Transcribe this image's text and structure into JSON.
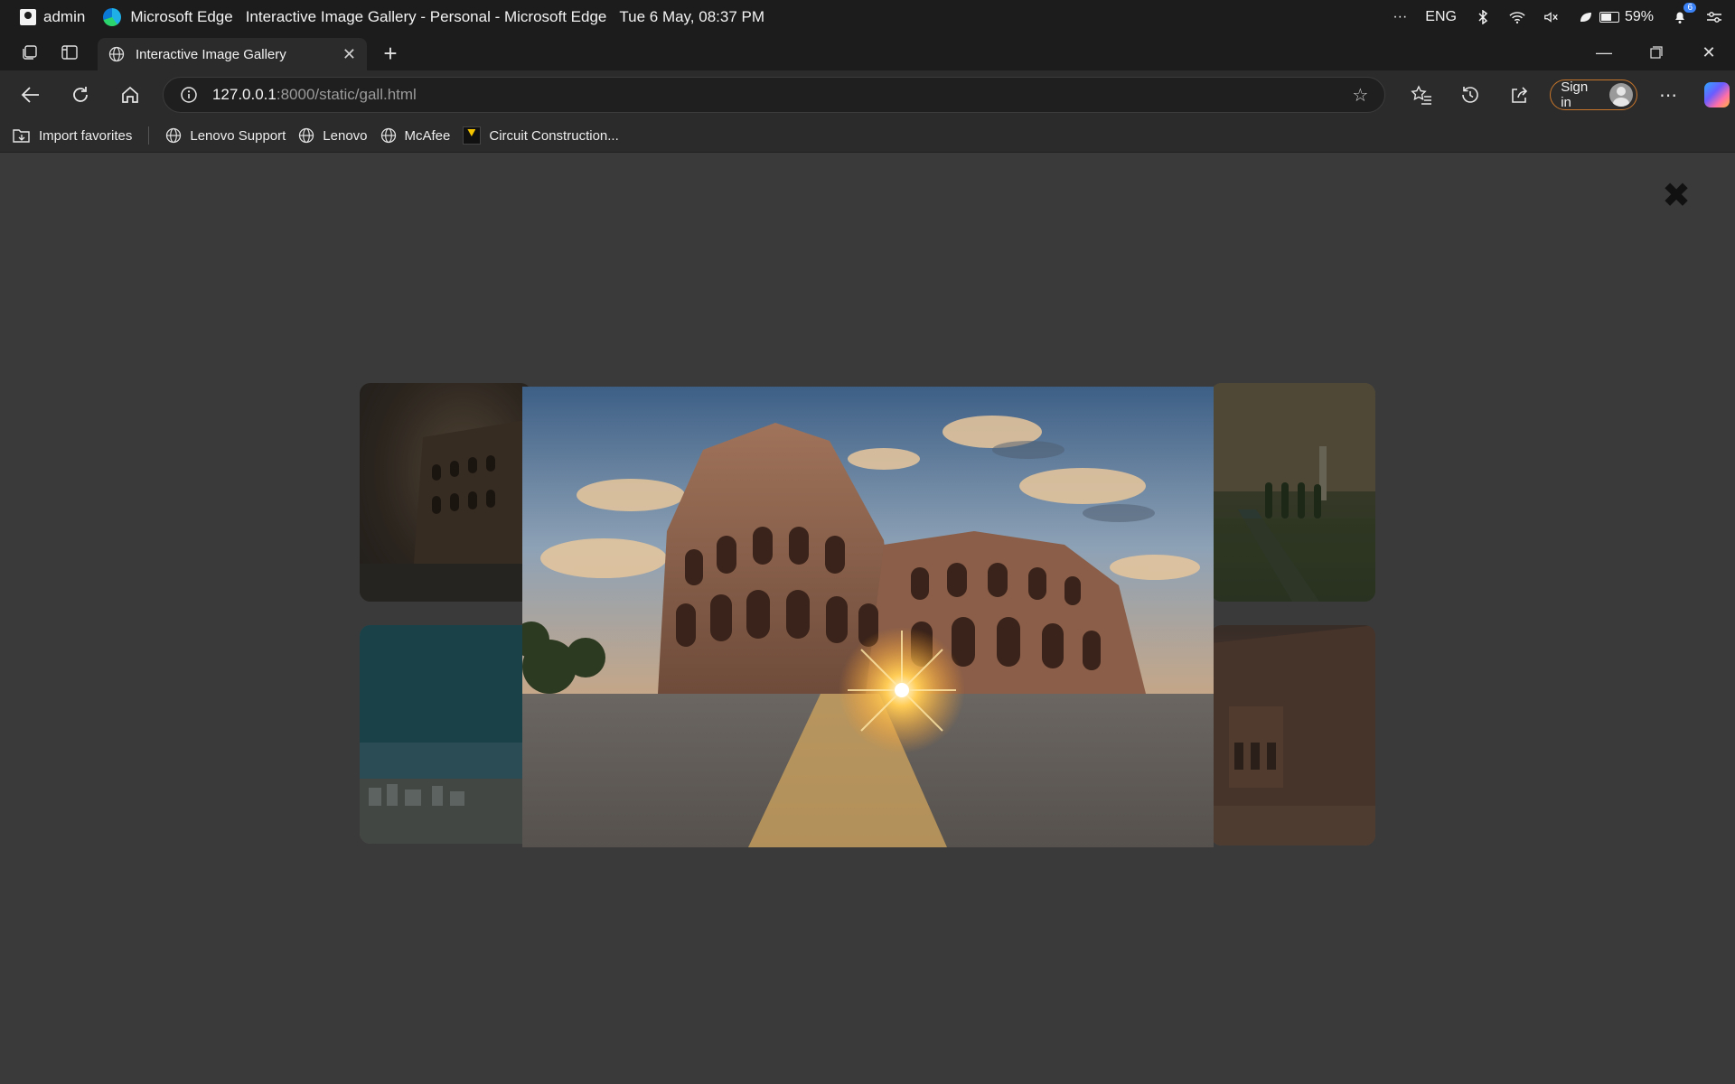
{
  "os": {
    "user": "admin",
    "app_name": "Microsoft Edge",
    "window_title": "Interactive Image Gallery - Personal - Microsoft Edge",
    "datetime": "Tue 6 May, 08:37 PM",
    "overflow": "···",
    "language": "ENG",
    "battery": "59%",
    "notification_count": "6"
  },
  "browser": {
    "tab_title": "Interactive Image Gallery",
    "url_host": "127.0.0.1",
    "url_path": ":8000/static/gall.html",
    "signin_label": "Sign in"
  },
  "favorites": [
    {
      "label": "Import favorites",
      "icon": "import-icon"
    },
    {
      "label": "Lenovo Support",
      "icon": "globe-icon"
    },
    {
      "label": "Lenovo",
      "icon": "globe-icon"
    },
    {
      "label": "McAfee",
      "icon": "globe-icon"
    },
    {
      "label": "Circuit Construction...",
      "icon": "phet-icon"
    }
  ],
  "gallery": {
    "close_label": "✖",
    "thumbnails": [
      "colosseum",
      "taj-mahal",
      "coastline",
      "petra"
    ],
    "lightbox_image": "colosseum"
  }
}
